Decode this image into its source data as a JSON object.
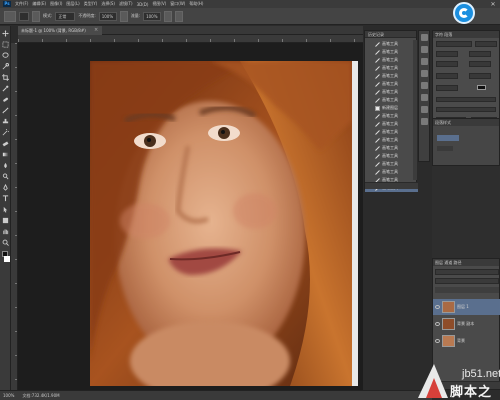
{
  "menubar": {
    "logo": "Ps",
    "items": [
      "文件(F)",
      "编辑(E)",
      "图像(I)",
      "图层(L)",
      "类型(Y)",
      "选择(S)",
      "滤镜(T)",
      "3D(D)",
      "视图(V)",
      "窗口(W)",
      "帮助(H)"
    ]
  },
  "options": {
    "mode_label": "模式:",
    "mode_value": "正常",
    "opacity_label": "不透明度:",
    "opacity_value": "100%",
    "flow_label": "流量:",
    "flow_value": "100%"
  },
  "document_tab": {
    "title": "未标题-1 @ 100% (背景, RGB/8#)",
    "close": "×"
  },
  "history": {
    "title": "历史记录",
    "items": [
      {
        "label": "画笔工具",
        "icon": "brush"
      },
      {
        "label": "画笔工具",
        "icon": "brush"
      },
      {
        "label": "画笔工具",
        "icon": "brush"
      },
      {
        "label": "画笔工具",
        "icon": "brush"
      },
      {
        "label": "画笔工具",
        "icon": "brush"
      },
      {
        "label": "画笔工具",
        "icon": "brush"
      },
      {
        "label": "画笔工具",
        "icon": "brush"
      },
      {
        "label": "画笔工具",
        "icon": "brush"
      },
      {
        "label": "新建图层",
        "icon": "doc"
      },
      {
        "label": "画笔工具",
        "icon": "brush"
      },
      {
        "label": "画笔工具",
        "icon": "brush"
      },
      {
        "label": "画笔工具",
        "icon": "brush"
      },
      {
        "label": "画笔工具",
        "icon": "brush"
      },
      {
        "label": "画笔工具",
        "icon": "brush"
      },
      {
        "label": "画笔工具",
        "icon": "brush"
      },
      {
        "label": "画笔工具",
        "icon": "brush"
      },
      {
        "label": "画笔工具",
        "icon": "brush"
      },
      {
        "label": "画笔工具",
        "icon": "brush"
      },
      {
        "label": "画笔工具",
        "icon": "brush"
      }
    ],
    "selected_index": 18
  },
  "character_panel": {
    "tabs": "字符  段落",
    "font": "宋体"
  },
  "paragraph_panel": {
    "tabs": "段落样式"
  },
  "layers": {
    "tabs": "图层  通道  路径",
    "items": [
      {
        "name": "图层 1"
      },
      {
        "name": "背景 副本"
      },
      {
        "name": "背景"
      }
    ],
    "selected_index": 0
  },
  "status": {
    "zoom": "100%",
    "doc": "文档:732.4K/1.90M"
  },
  "watermark": {
    "url": "jb51.net",
    "site": "脚本之家"
  },
  "colors": {
    "accent_blue": "#1b8fe0",
    "selection": "#5a6f8e",
    "hair": "#9a4a1c",
    "skin": "#d9a07c"
  }
}
